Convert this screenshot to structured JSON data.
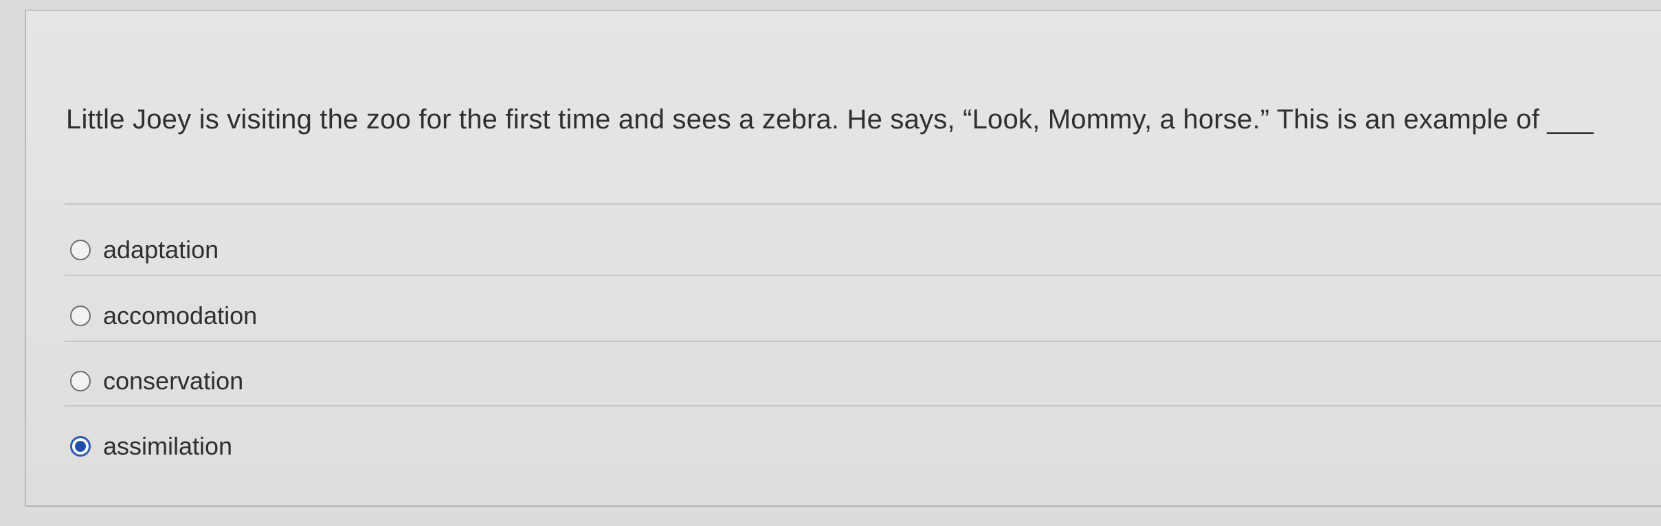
{
  "question": {
    "text": "Little Joey is visiting the zoo for the first time and sees a zebra. He says, “Look, Mommy, a horse.” This is an example of ___"
  },
  "answers": [
    {
      "label": "adaptation",
      "selected": false
    },
    {
      "label": "accomodation",
      "selected": false
    },
    {
      "label": "conservation",
      "selected": false
    },
    {
      "label": "assimilation",
      "selected": true
    }
  ],
  "colors": {
    "selected_radio": "#1f4fa8",
    "text": "#2f2f2f",
    "background": "#e3e2e0"
  }
}
